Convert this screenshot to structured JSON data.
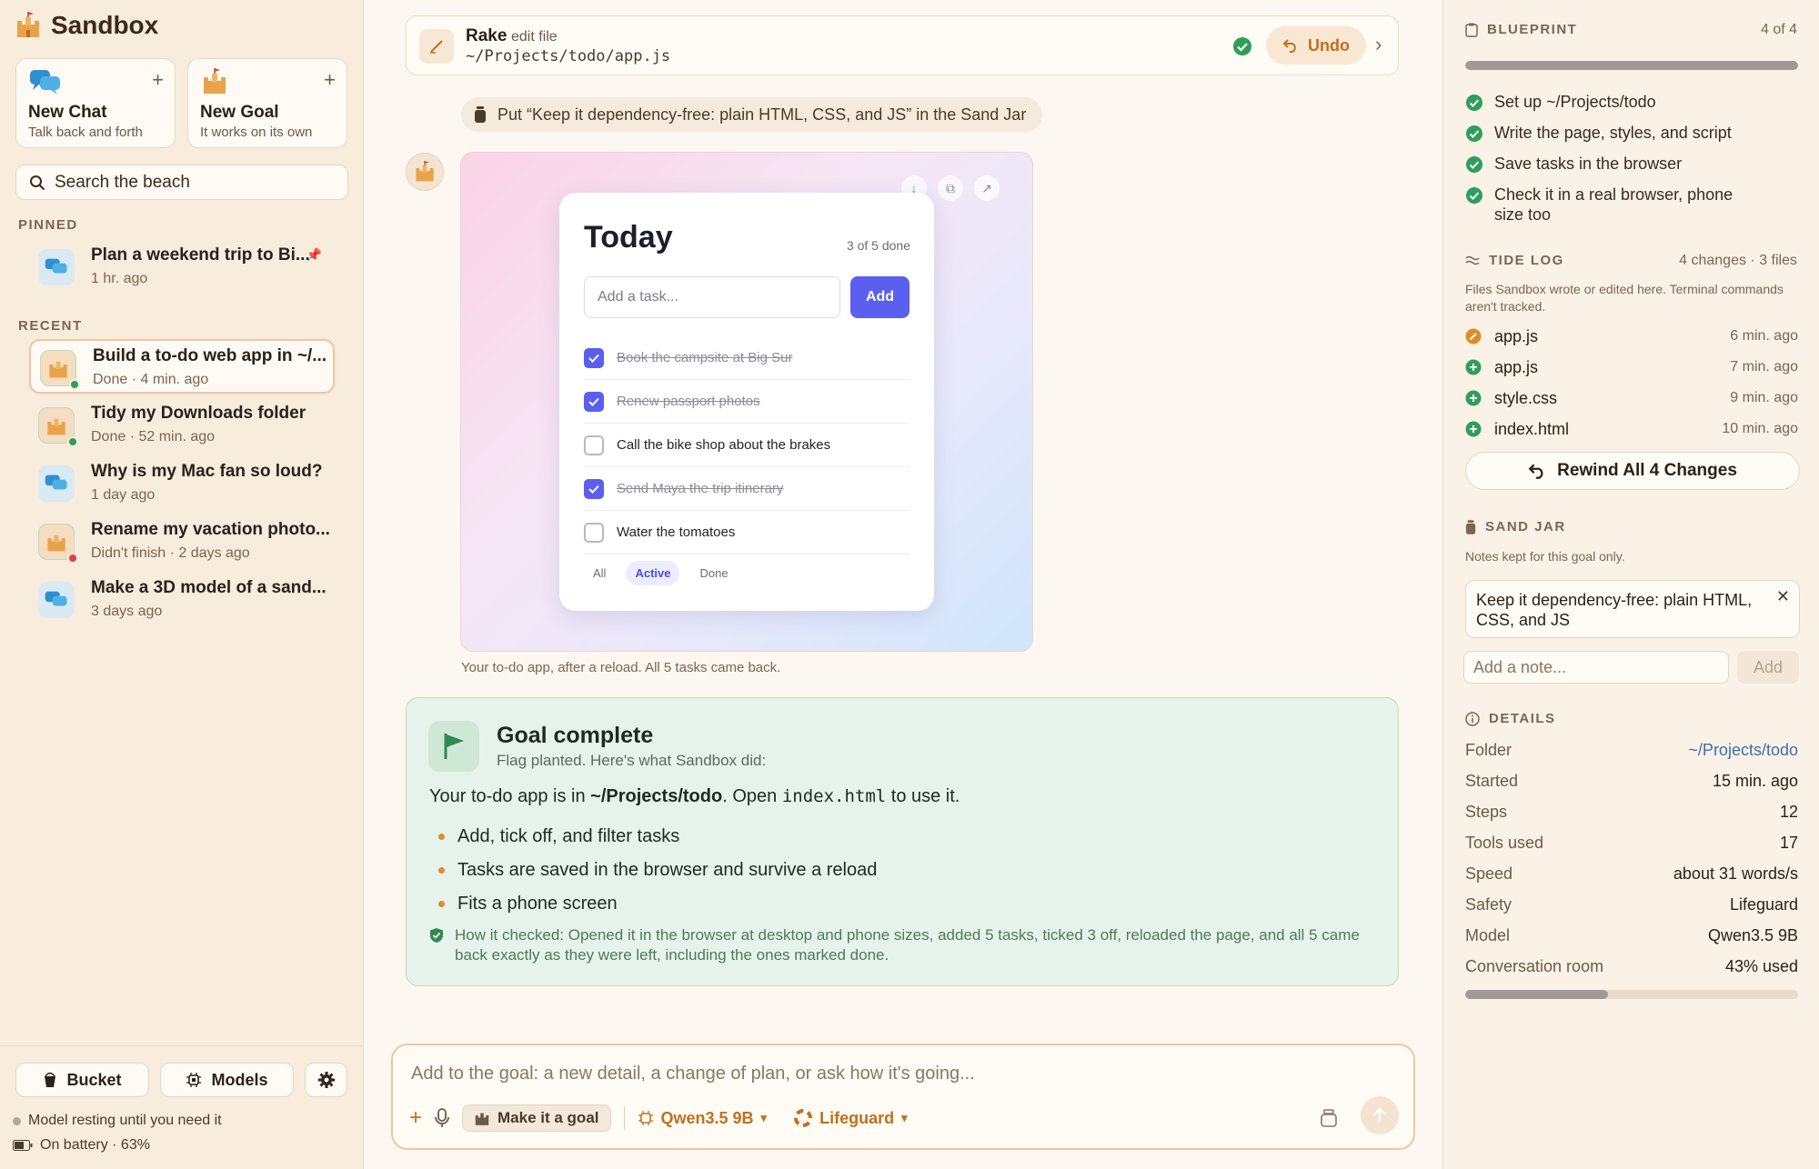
{
  "app": {
    "name": "Sandbox"
  },
  "sidebar": {
    "new_chat": {
      "title": "New Chat",
      "subtitle": "Talk back and forth"
    },
    "new_goal": {
      "title": "New Goal",
      "subtitle": "It works on its own"
    },
    "search_placeholder": "Search the beach",
    "pinned_label": "PINNED",
    "recent_label": "RECENT",
    "pinned": [
      {
        "title": "Plan a weekend trip to Bi...",
        "sub": "1 hr. ago",
        "kind": "chat"
      }
    ],
    "recent": [
      {
        "title": "Build a to-do web app in ~/...",
        "sub": "Done · 4 min. ago",
        "kind": "goal",
        "status": "done"
      },
      {
        "title": "Tidy my Downloads folder",
        "sub": "Done · 52 min. ago",
        "kind": "goal",
        "status": "done"
      },
      {
        "title": "Why is my Mac fan so loud?",
        "sub": "1 day ago",
        "kind": "chat"
      },
      {
        "title": "Rename my vacation photo...",
        "sub": "Didn't finish · 2 days ago",
        "kind": "goal",
        "status": "failed"
      },
      {
        "title": "Make a 3D model of a sand...",
        "sub": "3 days ago",
        "kind": "chat"
      }
    ],
    "footer": {
      "bucket": "Bucket",
      "models": "Models",
      "status1": "Model resting until you need it",
      "status2": "On battery · 63%"
    }
  },
  "main": {
    "tool": {
      "name": "Rake",
      "action": "edit file",
      "path": "~/Projects/todo/app.js",
      "undo": "Undo"
    },
    "jar_note": "Put “Keep it dependency-free: plain HTML, CSS, and JS” in the Sand Jar",
    "todo_app": {
      "title": "Today",
      "count": "3 of 5 done",
      "placeholder": "Add a task...",
      "add": "Add",
      "tasks": [
        {
          "label": "Book the campsite at Big Sur",
          "done": true
        },
        {
          "label": "Renew passport photos",
          "done": true
        },
        {
          "label": "Call the bike shop about the brakes",
          "done": false
        },
        {
          "label": "Send Maya the trip itinerary",
          "done": true
        },
        {
          "label": "Water the tomatoes",
          "done": false
        }
      ],
      "filters": [
        "All",
        "Active",
        "Done"
      ],
      "active_filter": "Active"
    },
    "caption": "Your to-do app, after a reload. All 5 tasks came back.",
    "goal": {
      "title": "Goal complete",
      "subtitle": "Flag planted. Here's what Sandbox did:",
      "line_pre": "Your to-do app is in ",
      "line_path": "~/Projects/todo",
      "line_mid": ". Open ",
      "line_file": "index.html",
      "line_post": " to use it.",
      "bullets": [
        "Add, tick off, and filter tasks",
        "Tasks are saved in the browser and survive a reload",
        "Fits a phone screen"
      ],
      "check": "How it checked: Opened it in the browser at desktop and phone sizes, added 5 tasks, ticked 3 off, reloaded the page, and all 5 came back exactly as they were left, including the ones marked done."
    },
    "composer": {
      "placeholder": "Add to the goal: a new detail, a change of plan, or ask how it's going...",
      "make_goal": "Make it a goal",
      "model": "Qwen3.5 9B",
      "safety": "Lifeguard"
    }
  },
  "right": {
    "blueprint": {
      "label": "BLUEPRINT",
      "count": "4 of 4",
      "progress": 1.0,
      "items": [
        "Set up ~/Projects/todo",
        "Write the page, styles, and script",
        "Save tasks in the browser",
        "Check it in a real browser, phone size too"
      ]
    },
    "tide_log": {
      "label": "TIDE LOG",
      "meta": "4 changes · 3 files",
      "note": "Files Sandbox wrote or edited here. Terminal commands aren't tracked.",
      "entries": [
        {
          "file": "app.js",
          "time": "6 min. ago",
          "kind": "edit"
        },
        {
          "file": "app.js",
          "time": "7 min. ago",
          "kind": "new"
        },
        {
          "file": "style.css",
          "time": "9 min. ago",
          "kind": "new"
        },
        {
          "file": "index.html",
          "time": "10 min. ago",
          "kind": "new"
        }
      ],
      "rewind": "Rewind All 4 Changes"
    },
    "sand_jar": {
      "label": "SAND JAR",
      "note": "Notes kept for this goal only.",
      "item": "Keep it dependency-free: plain HTML, CSS, and JS",
      "placeholder": "Add a note...",
      "add": "Add"
    },
    "details": {
      "label": "DETAILS",
      "rows": [
        {
          "k": "Folder",
          "v": "~/Projects/todo"
        },
        {
          "k": "Started",
          "v": "15 min. ago"
        },
        {
          "k": "Steps",
          "v": "12"
        },
        {
          "k": "Tools used",
          "v": "17"
        },
        {
          "k": "Speed",
          "v": "about 31 words/s"
        },
        {
          "k": "Safety",
          "v": "Lifeguard"
        },
        {
          "k": "Model",
          "v": "Qwen3.5 9B"
        },
        {
          "k": "Conversation room",
          "v": "43% used"
        }
      ],
      "room_used": 0.43
    }
  },
  "colors": {
    "accent": "#c0711d",
    "done_green": "#2f9e5a",
    "failed_red": "#e04040",
    "todo_blue": "#5b5ff0"
  }
}
